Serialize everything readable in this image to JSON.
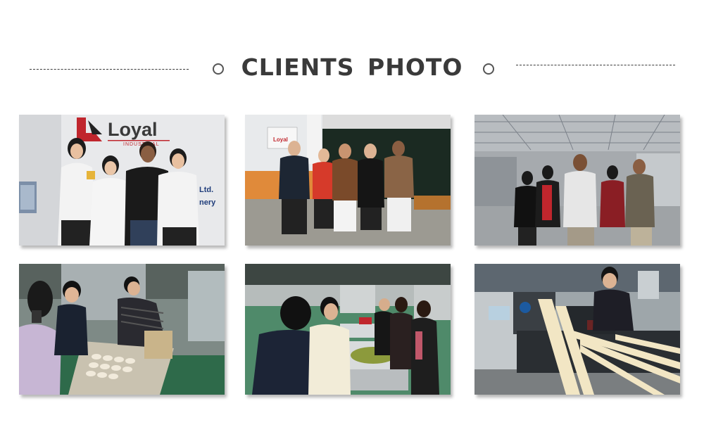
{
  "header": {
    "title": "CLIENTS PHOTO"
  },
  "photo1": {
    "brand": "Loyal",
    "sub_brand": "INDUSTRIAL",
    "wall_text_1": "Ltd.",
    "wall_text_2": "nery"
  },
  "photo2": {
    "sign_brand": "Loyal"
  },
  "colors": {
    "title": "#3a3a3a",
    "brand_red": "#c0262d",
    "dash": "#3a3a3a"
  }
}
